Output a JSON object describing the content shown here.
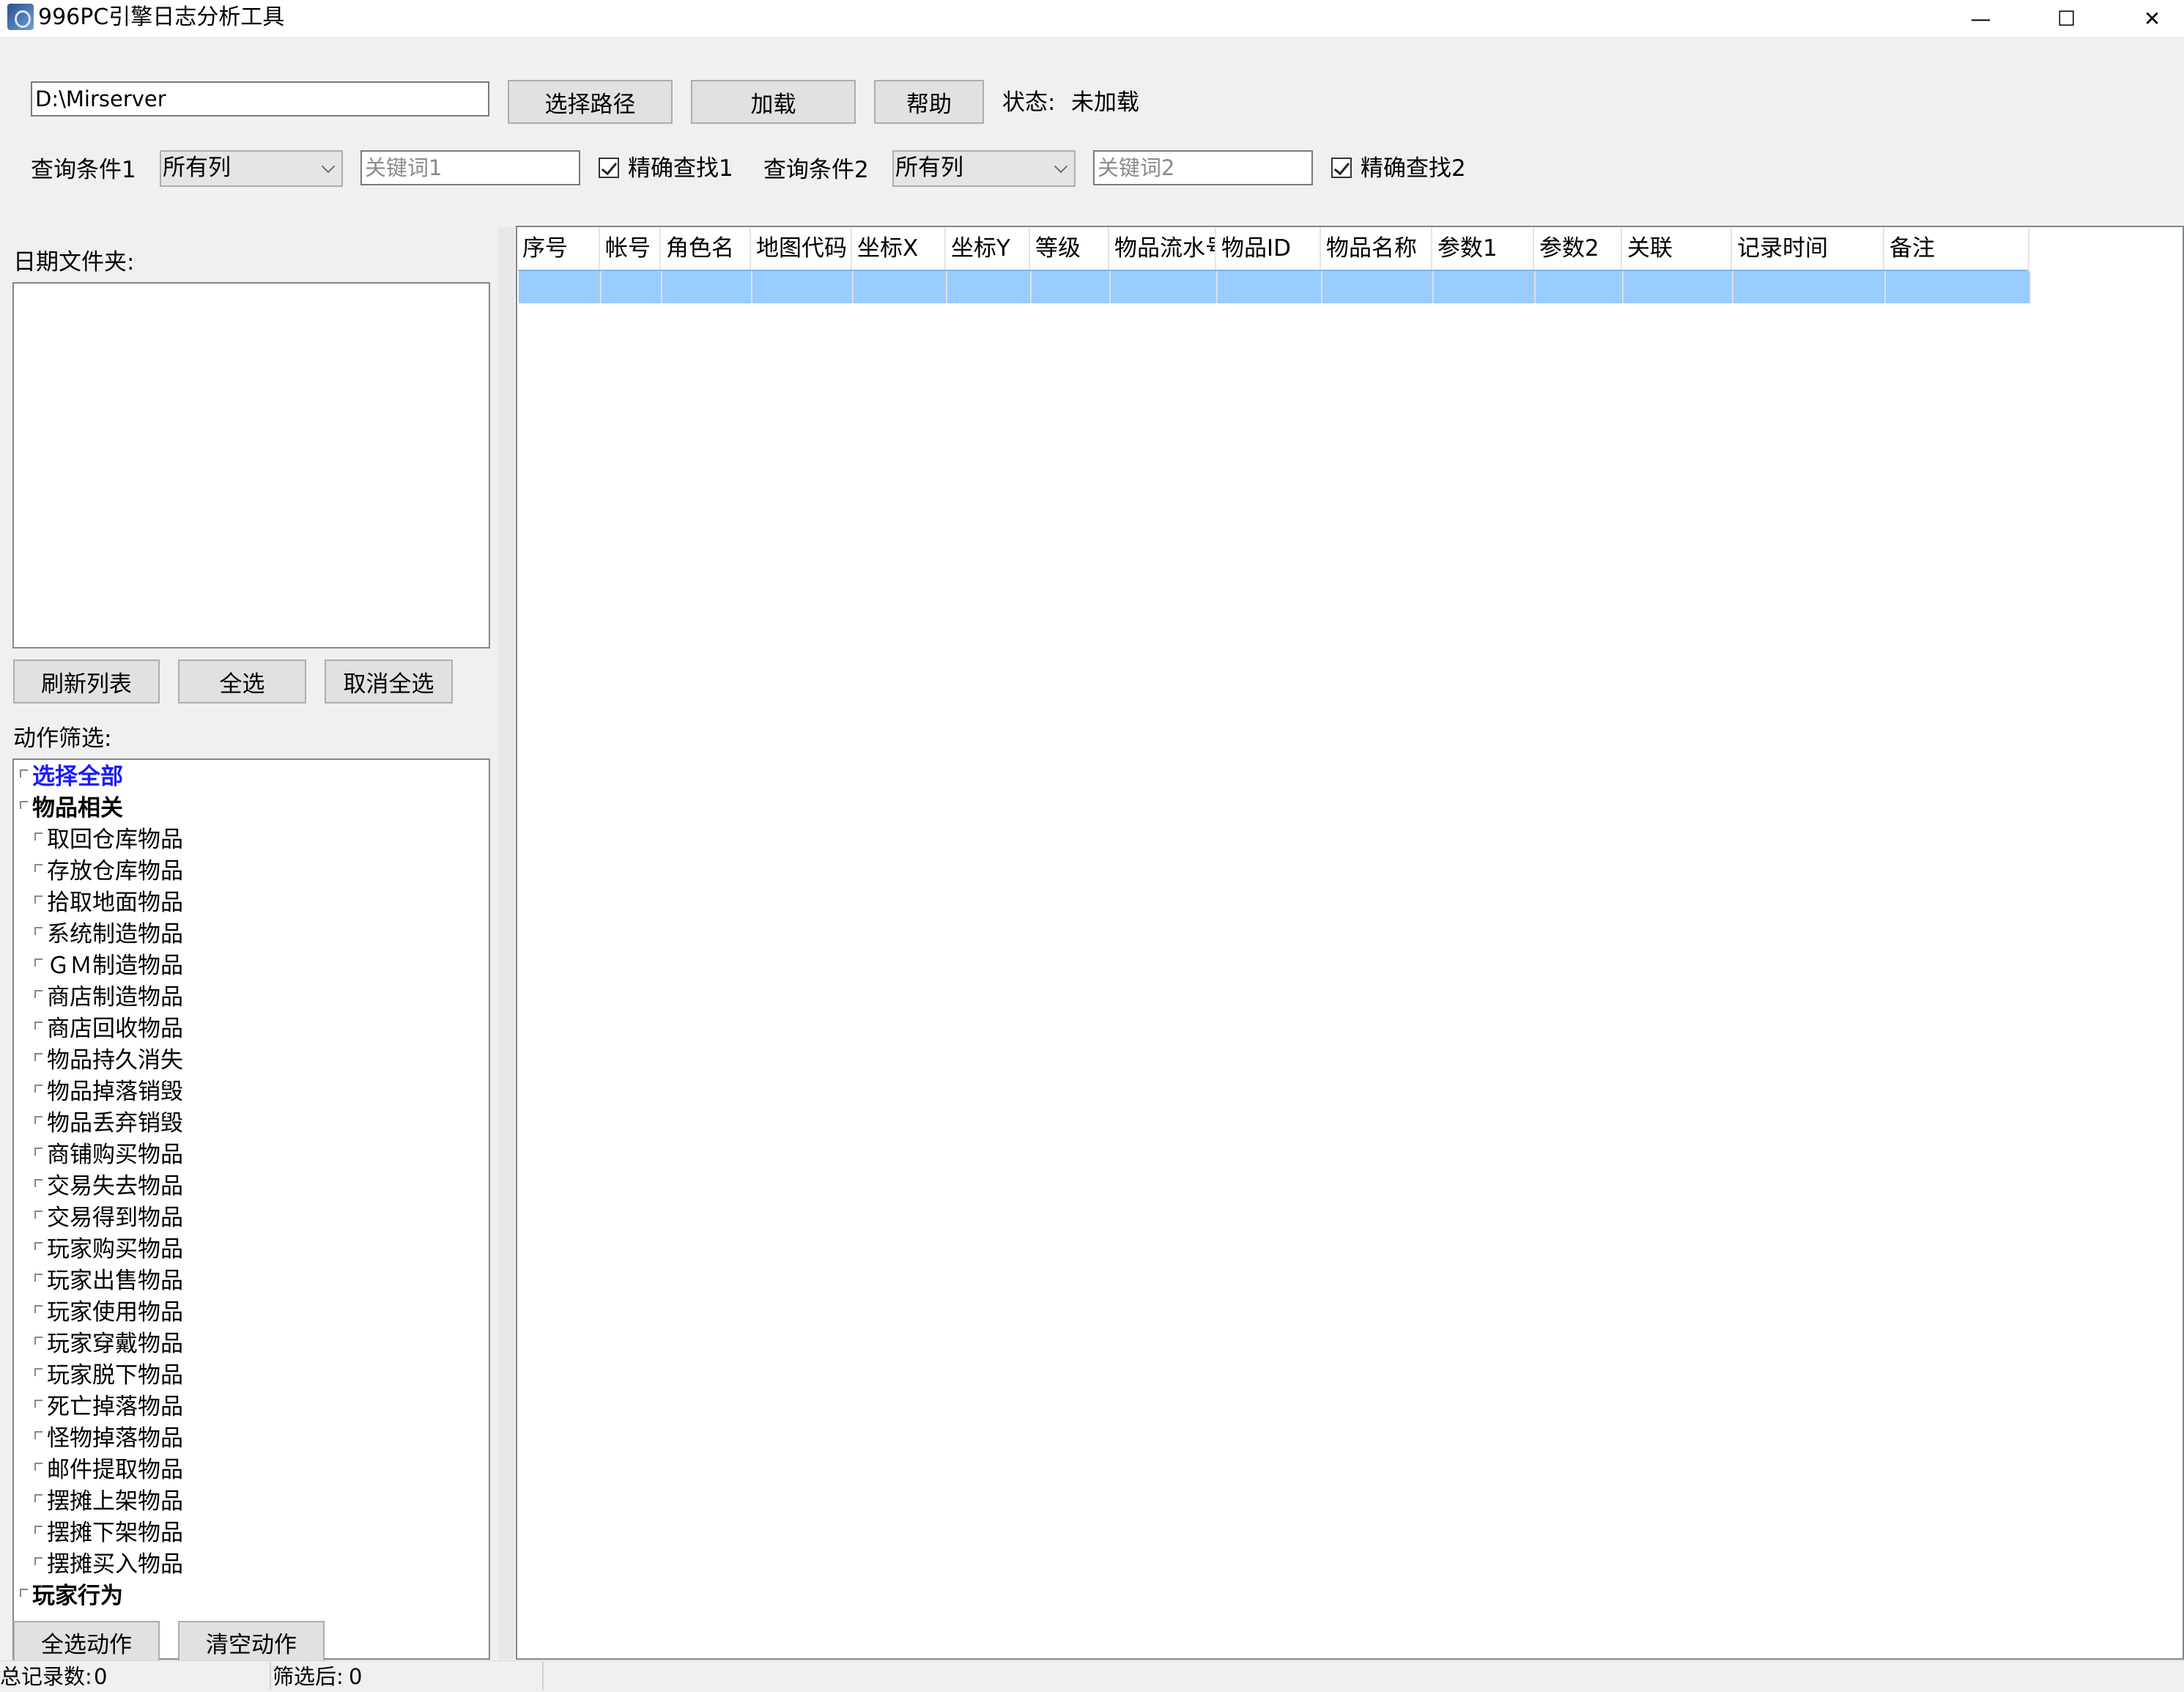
{
  "window": {
    "title": "996PC引擎日志分析工具",
    "minimize_glyph": "—",
    "maximize_glyph": "☐",
    "close_glyph": "✕"
  },
  "toolbar": {
    "path_value": "D:\\Mirserver",
    "select_path_label": "选择路径",
    "load_label": "加载",
    "help_label": "帮助",
    "status_label": "状态:",
    "status_value": "未加载"
  },
  "query": {
    "cond1_label": "查询条件1",
    "cond1_selected": "所有列",
    "keyword1_placeholder": "关键词1",
    "exact1_label": "精确查找1",
    "exact1_checked": true,
    "cond2_label": "查询条件2",
    "cond2_selected": "所有列",
    "keyword2_placeholder": "关键词2",
    "exact2_label": "精确查找2",
    "exact2_checked": true
  },
  "left": {
    "date_folder_label": "日期文件夹:",
    "refresh_label": "刷新列表",
    "select_all_label": "全选",
    "deselect_label": "取消全选",
    "action_filter_label": "动作筛选:",
    "tree": [
      {
        "label": "选择全部",
        "level": 0,
        "style": "link"
      },
      {
        "label": "物品相关",
        "level": 0,
        "style": "bold"
      },
      {
        "label": "取回仓库物品",
        "level": 1
      },
      {
        "label": "存放仓库物品",
        "level": 1
      },
      {
        "label": "拾取地面物品",
        "level": 1
      },
      {
        "label": "系统制造物品",
        "level": 1
      },
      {
        "label": "ＧＭ制造物品",
        "level": 1
      },
      {
        "label": "商店制造物品",
        "level": 1
      },
      {
        "label": "商店回收物品",
        "level": 1
      },
      {
        "label": "物品持久消失",
        "level": 1
      },
      {
        "label": "物品掉落销毁",
        "level": 1
      },
      {
        "label": "物品丢弃销毁",
        "level": 1
      },
      {
        "label": "商铺购买物品",
        "level": 1
      },
      {
        "label": "交易失去物品",
        "level": 1
      },
      {
        "label": "交易得到物品",
        "level": 1
      },
      {
        "label": "玩家购买物品",
        "level": 1
      },
      {
        "label": "玩家出售物品",
        "level": 1
      },
      {
        "label": "玩家使用物品",
        "level": 1
      },
      {
        "label": "玩家穿戴物品",
        "level": 1
      },
      {
        "label": "玩家脱下物品",
        "level": 1
      },
      {
        "label": "死亡掉落物品",
        "level": 1
      },
      {
        "label": "怪物掉落物品",
        "level": 1
      },
      {
        "label": "邮件提取物品",
        "level": 1
      },
      {
        "label": "摆摊上架物品",
        "level": 1
      },
      {
        "label": "摆摊下架物品",
        "level": 1
      },
      {
        "label": "摆摊买入物品",
        "level": 1
      },
      {
        "label": "玩家行为",
        "level": 0,
        "style": "bold"
      }
    ],
    "select_actions_label": "全选动作",
    "clear_actions_label": "清空动作"
  },
  "table": {
    "columns": [
      "序号",
      "帐号",
      "角色名",
      "地图代码",
      "坐标X",
      "坐标Y",
      "等级",
      "物品流水号",
      "物品ID",
      "物品名称",
      "参数1",
      "参数2",
      "关联",
      "记录时间",
      "备注"
    ],
    "selected_row_color": "#99ccff"
  },
  "statusbar": {
    "total_label": "总记录数:",
    "total_value": "0",
    "filtered_label": "筛选后:",
    "filtered_value": "0"
  }
}
